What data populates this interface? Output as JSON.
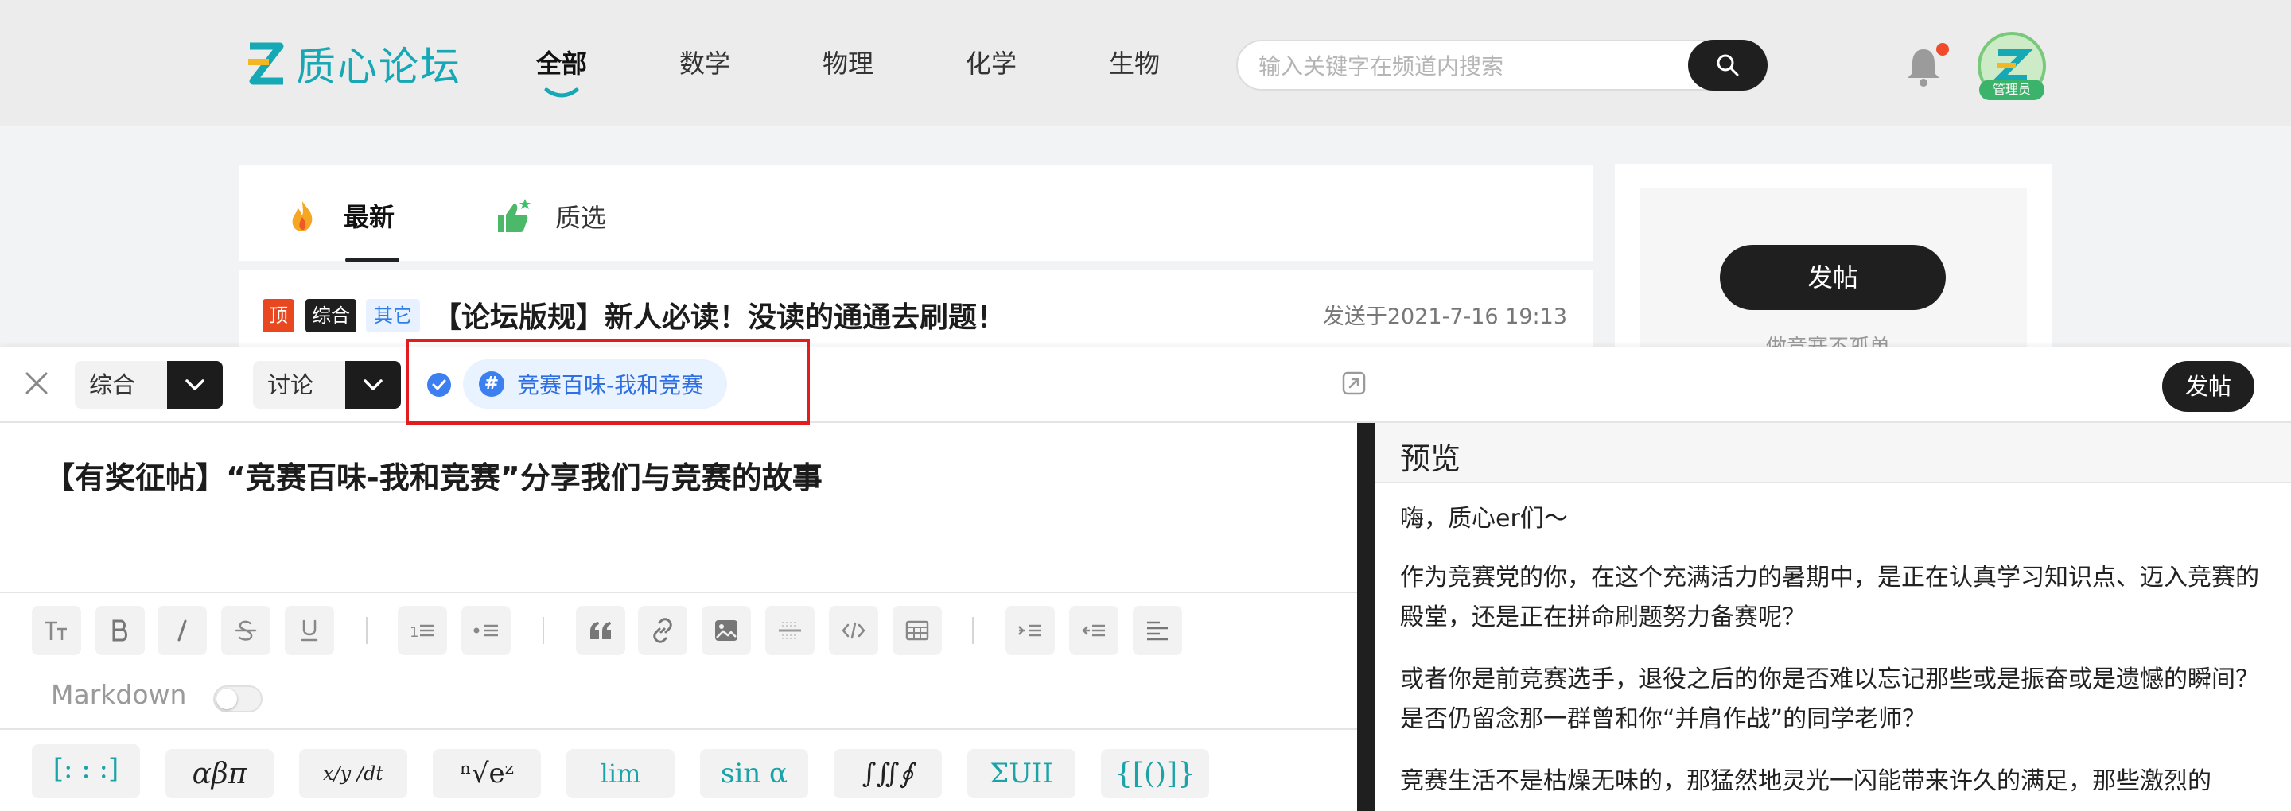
{
  "header": {
    "logo_text": "质心论坛",
    "nav": [
      {
        "label": "全部",
        "active": true
      },
      {
        "label": "数学",
        "active": false
      },
      {
        "label": "物理",
        "active": false
      },
      {
        "label": "化学",
        "active": false
      },
      {
        "label": "生物",
        "active": false
      }
    ],
    "search_placeholder": "输入关键字在频道内搜索",
    "admin_badge": "管理员",
    "notification_dot_color": "#f04a2b"
  },
  "feed": {
    "tabs": [
      {
        "label": "最新",
        "icon": "fire-icon",
        "active": true
      },
      {
        "label": "质选",
        "icon": "thumbs-up-icon",
        "active": false
      }
    ],
    "post": {
      "badges": [
        {
          "label": "顶",
          "bg": "#e8471f",
          "color": "#ffffff"
        },
        {
          "label": "综合",
          "bg": "#1f1f1f",
          "color": "#ffffff"
        },
        {
          "label": "其它",
          "bg": "#e8f1ff",
          "color": "#2f7fe8"
        }
      ],
      "title": "【论坛版规】新人必读！没读的通通去刷题！",
      "date": "发送于2021-7-16 19:13"
    }
  },
  "sidebar": {
    "post_button": "发帖",
    "hint": "做竞赛不孤单"
  },
  "editor": {
    "category_select": "综合",
    "type_select": "讨论",
    "topic": "竞赛百味-我和竞赛",
    "publish_button": "发帖",
    "title": "【有奖征帖】“竞赛百味-我和竞赛”分享我们与竞赛的故事",
    "markdown_label": "Markdown",
    "markdown_enabled": false,
    "format_tools": [
      "text-size-icon",
      "bold-icon",
      "italic-icon",
      "strikethrough-icon",
      "underline-icon",
      "ordered-list-icon",
      "bullet-list-icon",
      "quote-icon",
      "link-icon",
      "image-icon",
      "divider-icon",
      "code-icon",
      "table-icon",
      "indent-icon",
      "outdent-icon",
      "align-icon"
    ],
    "math_tools": [
      "×∩÷",
      "αβπ",
      "x/y /dt",
      "ⁿ√eᶻ",
      "lim",
      "sin α",
      "∫∬∮",
      "ΣUII",
      "{[()]}",
      "[: : :]"
    ]
  },
  "preview": {
    "title": "预览",
    "paragraphs": [
      "嗨，质心er们～",
      "作为竞赛党的你，在这个充满活力的暑期中，是正在认真学习知识点、迈入竞赛的殿堂，还是正在拼命刷题努力备赛呢？",
      "或者你是前竞赛选手，退役之后的你是否难以忘记那些或是振奋或是遗憾的瞬间？是否仍留念那一群曾和你“并肩作战”的同学老师？",
      "竞赛生活不是枯燥无味的，那猛然地灵光一闪能带来许久的满足，那些激烈的"
    ]
  }
}
